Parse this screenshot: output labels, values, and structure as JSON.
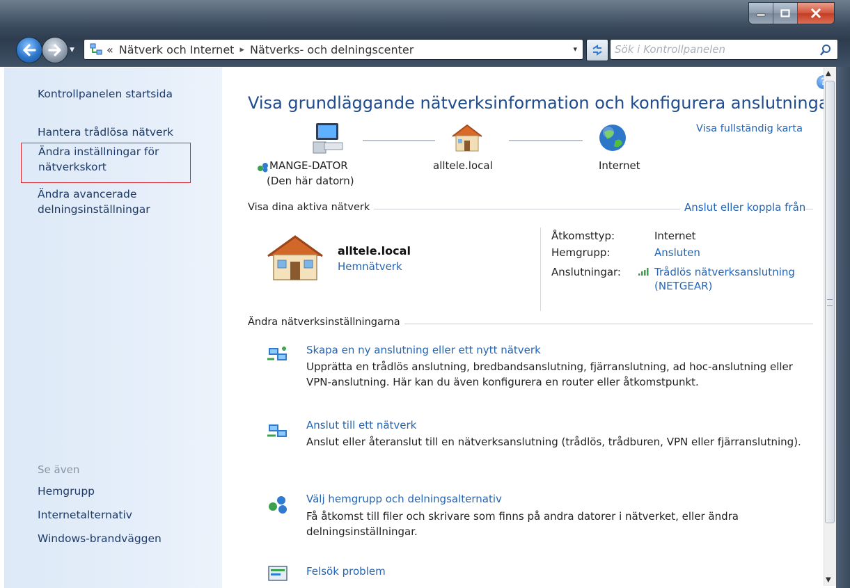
{
  "addressbar": {
    "chevron": "«",
    "crumb1": "Nätverk och Internet",
    "arrow": "▸",
    "crumb2": "Nätverks- och delningscenter",
    "dropdown": "▾"
  },
  "search": {
    "placeholder": "Sök i Kontrollpanelen"
  },
  "left_pane": {
    "home": "Kontrollpanelen startsida",
    "tasks": [
      "Hantera trådlösa nätverk",
      "Ändra inställningar för nätverkskort",
      "Ändra avancerade delningsinställningar"
    ],
    "task2_line1": "Ändra inställningar för",
    "task2_line2": "nätverkskort",
    "task3_line1": "Ändra avancerade",
    "task3_line2": "delningsinställningar",
    "see_also_header": "Se även",
    "see_also": [
      "Hemgrupp",
      "Internetalternativ",
      "Windows-brandväggen"
    ]
  },
  "main": {
    "title": "Visa grundläggande nätverksinformation och konfigurera anslutningar",
    "full_map_link": "Visa fullständig karta",
    "map": {
      "computer_name": "MANGE-DATOR",
      "computer_sub": "(Den här datorn)",
      "network_name": "alltele.local",
      "internet": "Internet"
    },
    "active_networks": {
      "header": "Visa dina aktiva nätverk",
      "connect_link": "Anslut eller koppla från",
      "network_name": "alltele.local",
      "network_type": "Hemnätverk",
      "access_type_label": "Åtkomsttyp:",
      "access_type_value": "Internet",
      "homegroup_label": "Hemgrupp:",
      "homegroup_value": "Ansluten",
      "connections_label": "Anslutningar:",
      "connections_value": "Trådlös nätverksanslutning",
      "connections_value2": "(NETGEAR)"
    },
    "change_settings": {
      "header": "Ändra nätverksinställningarna",
      "items": [
        {
          "title": "Skapa en ny anslutning eller ett nytt nätverk",
          "desc": "Upprätta en trådlös anslutning, bredbandsanslutning, fjärranslutning, ad hoc-anslutning eller VPN-anslutning. Här kan du även konfigurera en router eller åtkomstpunkt."
        },
        {
          "title": "Anslut till ett nätverk",
          "desc": "Anslut eller återanslut till en nätverksanslutning (trådlös, trådburen, VPN eller fjärranslutning)."
        },
        {
          "title": "Välj hemgrupp och delningsalternativ",
          "desc": "Få åtkomst till filer och skrivare som finns på andra datorer i nätverket, eller ändra delningsinställningar."
        },
        {
          "title": "Felsök problem",
          "desc": ""
        }
      ]
    }
  }
}
